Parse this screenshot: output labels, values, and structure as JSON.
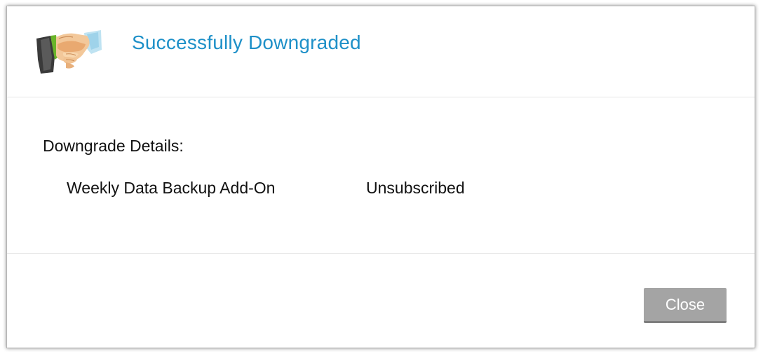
{
  "dialog": {
    "title": "Successfully Downgraded",
    "icon": "handshake-icon",
    "details_heading": "Downgrade Details:",
    "details": [
      {
        "name": "Weekly Data Backup Add-On",
        "status": "Unsubscribed"
      }
    ],
    "close_label": "Close"
  },
  "colors": {
    "title": "#1e90c8",
    "button_bg": "#a4a4a4",
    "button_text": "#ffffff"
  }
}
